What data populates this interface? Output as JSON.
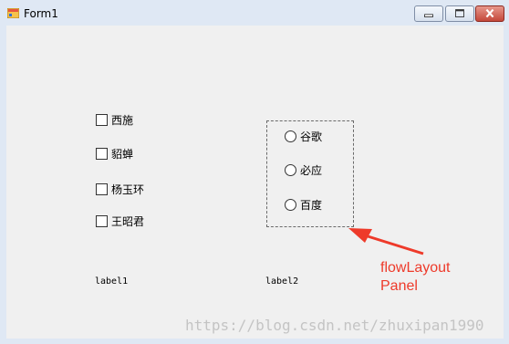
{
  "window": {
    "title": "Form1",
    "icons": {
      "app": "form-icon",
      "minimize": "minimize-icon",
      "maximize": "maximize-icon",
      "close": "close-icon"
    }
  },
  "checkboxes": [
    {
      "label": "西施",
      "checked": false
    },
    {
      "label": "貂蝉",
      "checked": false
    },
    {
      "label": "杨玉环",
      "checked": false
    },
    {
      "label": "王昭君",
      "checked": false
    }
  ],
  "flow_panel": {
    "radios": [
      {
        "label": "谷歌",
        "selected": false
      },
      {
        "label": "必应",
        "selected": false
      },
      {
        "label": "百度",
        "selected": false
      }
    ]
  },
  "labels": {
    "label1": "label1",
    "label2": "label2"
  },
  "annotation": {
    "line1": "flowLayout",
    "line2": "Panel",
    "color": "#ee3a2a"
  },
  "watermark": "https://blog.csdn.net/zhuxipan1990"
}
